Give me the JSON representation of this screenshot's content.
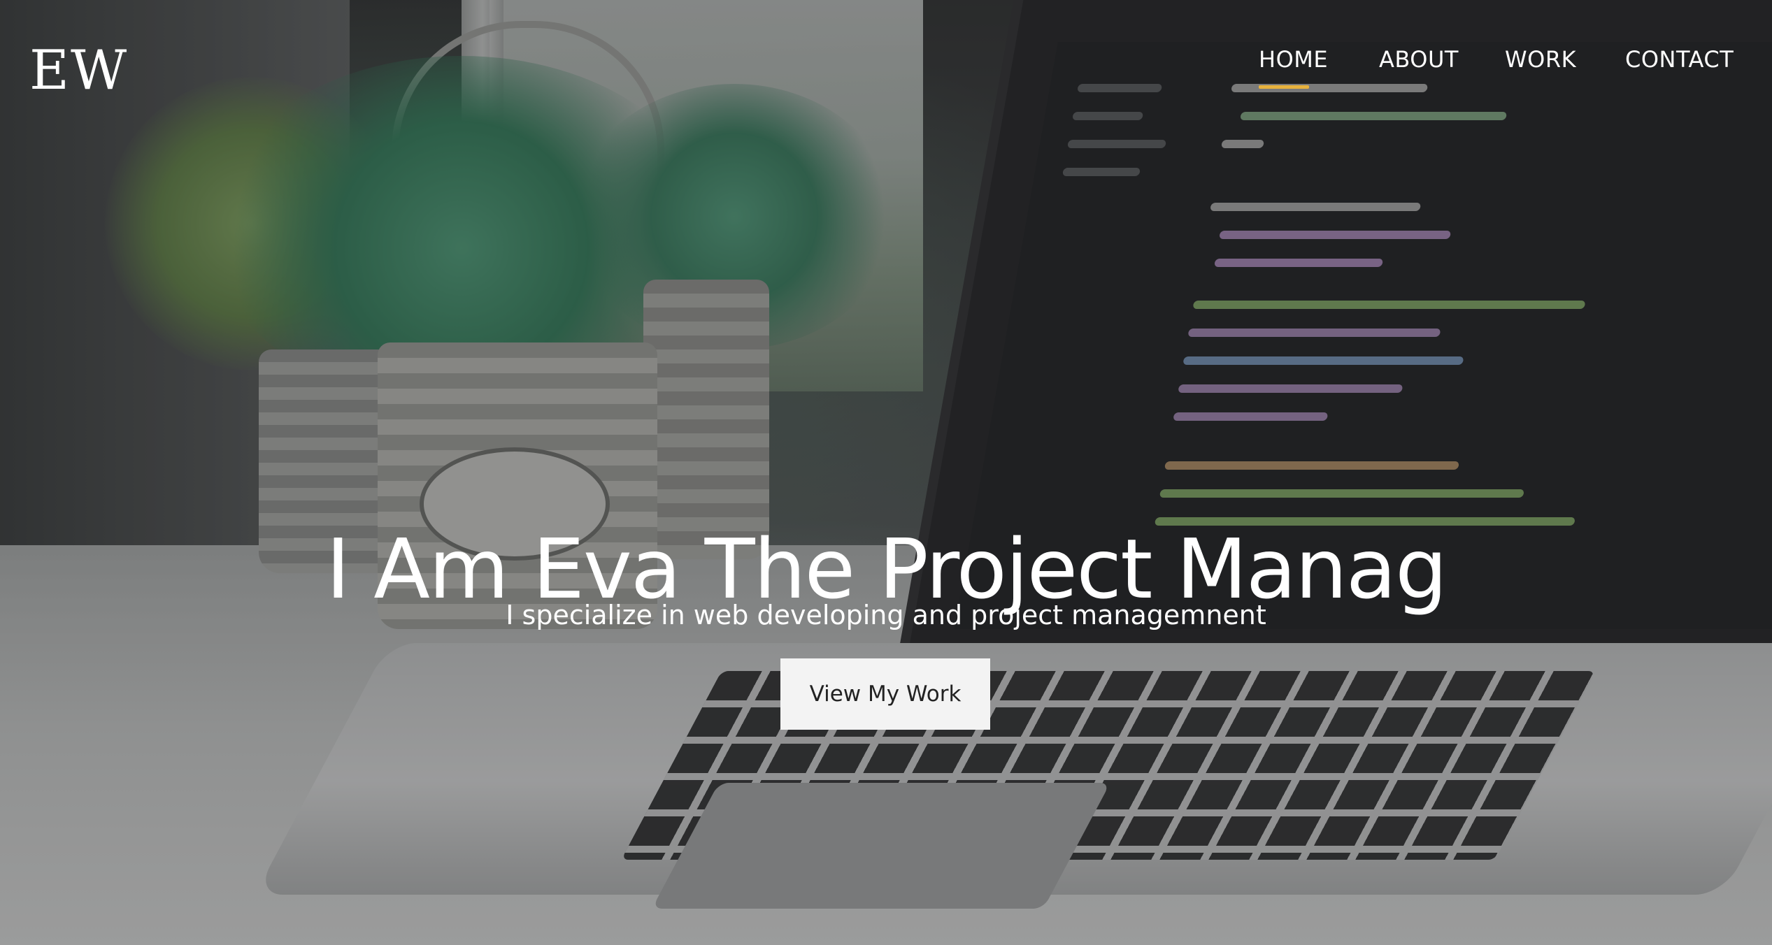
{
  "logo": {
    "text": "EW"
  },
  "nav": {
    "items": [
      {
        "label": "HOME",
        "active": true
      },
      {
        "label": "ABOUT",
        "active": false
      },
      {
        "label": "WORK",
        "active": false
      },
      {
        "label": "CONTACT",
        "active": false
      }
    ],
    "active_underline_color": "#e8b23d"
  },
  "hero": {
    "headline": "I Am Eva The Project Manag",
    "subheadline": "I specialize in web developing and project managemnent",
    "cta_label": "View My Work"
  },
  "colors": {
    "text": "#ffffff",
    "button_bg": "#f3f3f3",
    "button_text": "#222222"
  }
}
